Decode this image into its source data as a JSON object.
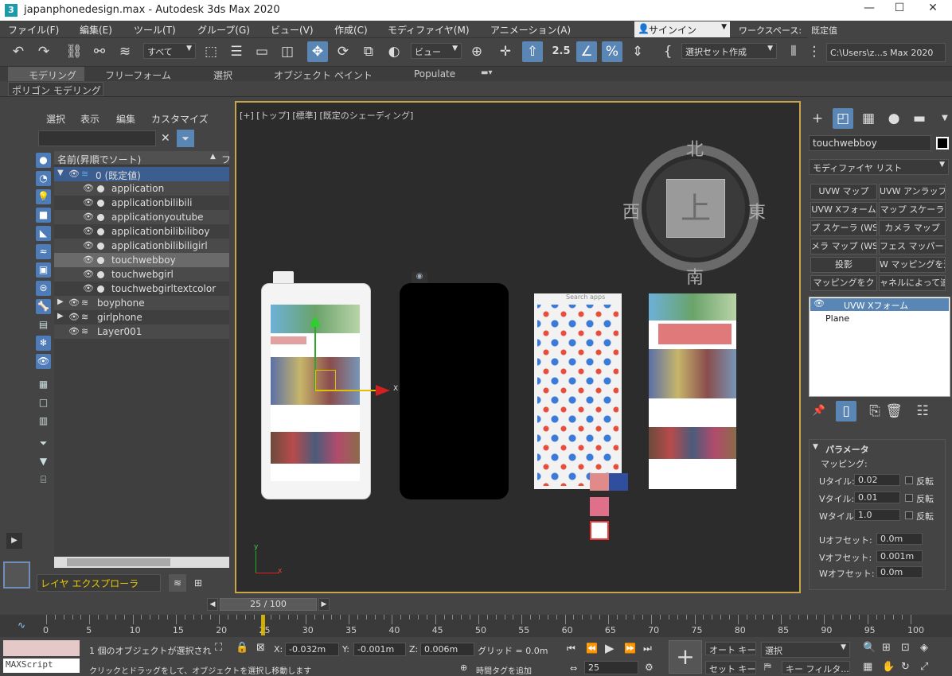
{
  "window": {
    "title": "japanphonedesign.max - Autodesk 3ds Max 2020",
    "app_icon": "3"
  },
  "menu": [
    {
      "label": "ファイル(F)"
    },
    {
      "label": "編集(E)"
    },
    {
      "label": "ツール(T)"
    },
    {
      "label": "グループ(G)"
    },
    {
      "label": "ビュー(V)"
    },
    {
      "label": "作成(C)"
    },
    {
      "label": "モディファイヤ(M)"
    },
    {
      "label": "アニメーション(A)"
    }
  ],
  "signin": "サインイン",
  "workspace": {
    "label": "ワークスペース:",
    "value": "既定值"
  },
  "toolbar": {
    "selection_filter": "すべて",
    "ref_coord": "ビュー",
    "selection_set": "選択セット作成",
    "project_path": "C:\\Users\\z...s Max 2020",
    "snap_value": "2.5"
  },
  "ribbon": {
    "tabs": [
      {
        "label": "モデリング"
      },
      {
        "label": "フリーフォーム"
      },
      {
        "label": "選択"
      },
      {
        "label": "オブジェクト ペイント"
      },
      {
        "label": "Populate"
      }
    ],
    "sub": "ポリゴン モデリング"
  },
  "scene_explorer": {
    "menu": [
      {
        "label": "選択"
      },
      {
        "label": "表示"
      },
      {
        "label": "編集"
      },
      {
        "label": "カスタマイズ"
      }
    ],
    "column_header": "名前(昇順でソート)",
    "column_header2": "フ",
    "rows": [
      {
        "label": "0 (既定値)"
      },
      {
        "label": "application"
      },
      {
        "label": "applicationbilibili"
      },
      {
        "label": "applicationyoutube"
      },
      {
        "label": "applicationbilibiliboy"
      },
      {
        "label": "applicationbilibiligirl"
      },
      {
        "label": "touchwebboy"
      },
      {
        "label": "touchwebgirl"
      },
      {
        "label": "touchwebgirltextcolor"
      },
      {
        "label": "boyphone"
      },
      {
        "label": "girlphone"
      },
      {
        "label": "Layer001"
      }
    ],
    "footer_label": "レイヤ エクスプローラ"
  },
  "viewport": {
    "label": "[+] [トップ] [標準] [既定のシェーディング]",
    "viewcube": {
      "top_face": "上",
      "north": "北",
      "south": "南",
      "east": "東",
      "west": "西"
    },
    "gizmo_x_label": "X",
    "axis_x": "x",
    "axis_y": "y",
    "search_apps": "Search apps"
  },
  "command_panel": {
    "object_name": "touchwebboy",
    "modifier_list": "モディファイヤ リスト",
    "modifier_buttons": [
      {
        "label": "UVW マップ"
      },
      {
        "label": "UVW アンラップ"
      },
      {
        "label": "UVW Xフォーム"
      },
      {
        "label": "マップ スケーラ"
      },
      {
        "label": "プ スケーラ (WS"
      },
      {
        "label": "カメラ マップ"
      },
      {
        "label": "メラ マップ (WSI"
      },
      {
        "label": "フェス マッパー ("
      },
      {
        "label": "投影"
      },
      {
        "label": "W マッピングを追"
      },
      {
        "label": "マッピングをク"
      },
      {
        "label": "ャネルによって追"
      }
    ],
    "stack": [
      {
        "label": "UVW Xフォーム"
      },
      {
        "label": "Plane"
      }
    ],
    "rollout_title": "パラメータ",
    "mapping_label": "マッピング:",
    "params": [
      {
        "label": "Uタイル:",
        "value": "0.02",
        "flip": "反転"
      },
      {
        "label": "Vタイル:",
        "value": "0.01",
        "flip": "反転"
      },
      {
        "label": "Wタイル:",
        "value": "1.0",
        "flip": "反転"
      }
    ],
    "offsets": [
      {
        "label": "Uオフセット:",
        "value": "0.0m"
      },
      {
        "label": "Vオフセット:",
        "value": "0.001m"
      },
      {
        "label": "Wオフセット:",
        "value": "0.0m"
      }
    ]
  },
  "timeline": {
    "slider_label": "25 / 100",
    "current_frame_fraction": 0.25,
    "ticks": [
      "0",
      "5",
      "10",
      "15",
      "20",
      "25",
      "30",
      "35",
      "40",
      "45",
      "50",
      "55",
      "60",
      "65",
      "70",
      "75",
      "80",
      "85",
      "90",
      "95",
      "100"
    ]
  },
  "status": {
    "maxscript": "MAXScript",
    "selection_info": "1 個のオブジェクトが選択され",
    "prompt": "クリックとドラッグをして、オブジェクトを選択し移動します",
    "x_label": "X:",
    "x_value": "-0.032m",
    "y_label": "Y:",
    "y_value": "-0.001m",
    "z_label": "Z:",
    "z_value": "0.006m",
    "grid": "グリッド = 0.0m",
    "add_tag": "時間タグを追加",
    "frame_value": "25",
    "autokey": "オート キー",
    "setkey": "セット キー",
    "key_mode": "選択",
    "key_filter": "キー フィルタ..."
  },
  "colors": {
    "accent": "#5a86b6",
    "viewport_border": "#c8a44a",
    "selection": "#3b5d8f"
  }
}
